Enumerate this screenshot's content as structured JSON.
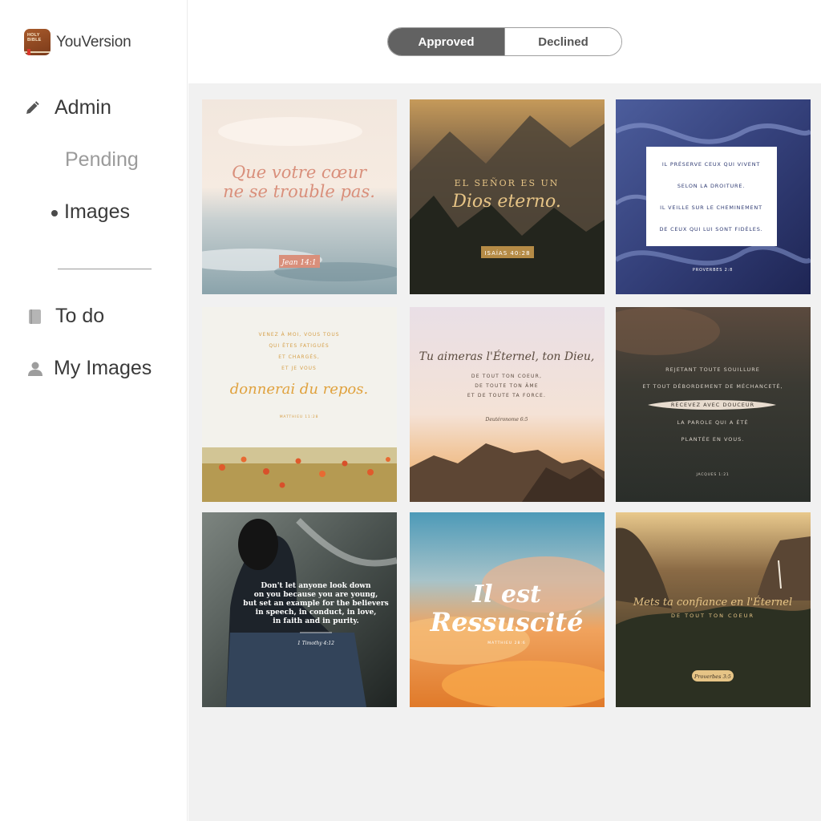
{
  "brand": {
    "name": "YouVersion",
    "logo_text": "HOLY BIBLE"
  },
  "nav": {
    "admin_label": "Admin",
    "pending_label": "Pending",
    "images_label": "Images",
    "todo_label": "To do",
    "my_images_label": "My Images"
  },
  "tabs": {
    "approved_label": "Approved",
    "declined_label": "Declined",
    "active": "Approved"
  },
  "images": [
    {
      "line1": "Que votre cœur",
      "line2": "ne se trouble pas.",
      "ref": "Jean 14:1"
    },
    {
      "line1": "EL SEÑOR ES UN",
      "line2": "Dios eterno.",
      "ref": "ISAÍAS 40:28"
    },
    {
      "lines": [
        "IL PRÉSERVE CEUX QUI VIVENT",
        "SELON LA DROITURE.",
        "IL VEILLE SUR LE CHEMINEMENT",
        "DE CEUX QUI LUI SONT FIDÈLES."
      ],
      "ref": "PROVERBES 2:8"
    },
    {
      "lines": [
        "VENEZ À MOI, VOUS TOUS",
        "QUI ÊTES FATIGUÉS",
        "ET CHARGÉS,",
        "ET JE VOUS"
      ],
      "script": "donnerai du repos.",
      "ref": "MATTHIEU 11:28"
    },
    {
      "script": "Tu aimeras l'Éternel, ton Dieu,",
      "lines": [
        "DE TOUT TON COEUR,",
        "DE TOUTE TON ÂME",
        "ET DE TOUTE TA FORCE."
      ],
      "ref": "Deutéronome 6:5"
    },
    {
      "lines": [
        "REJETANT TOUTE SOUILLURE",
        "ET TOUT DÉBORDEMENT DE MÉCHANCETÉ,",
        "RECEVEZ AVEC DOUCEUR",
        "LA PAROLE QUI A ÉTÉ",
        "PLANTÉE EN VOUS."
      ],
      "ref": "JACQUES 1:21"
    },
    {
      "lines": [
        "Don't let anyone look down",
        "on you because you are young,",
        "but set an example for the believers",
        "in speech, in conduct, in love,",
        "in faith and in purity."
      ],
      "ref": "1 Timothy 4:12"
    },
    {
      "line1": "Il est",
      "line2": "Ressuscité",
      "ref": "MATTHIEU 28:6"
    },
    {
      "script": "Mets ta confiance en l'Éternel",
      "sub": "DE TOUT TON COEUR",
      "ref": "Proverbes 3:5"
    }
  ]
}
